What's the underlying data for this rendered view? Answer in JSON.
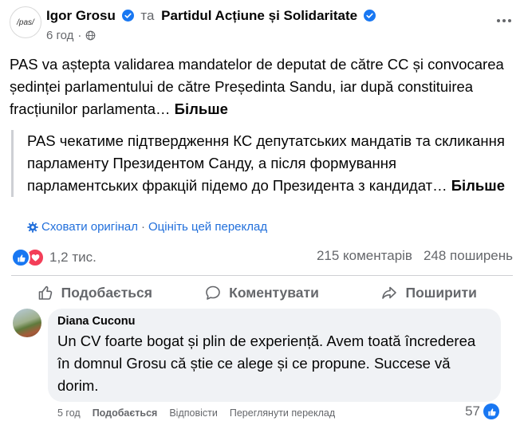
{
  "post": {
    "author": "Igor Grosu",
    "separator": "та",
    "page_name": "Partidul Acțiune și Solidaritate",
    "page_avatar_text": "/pas/",
    "time": "6 год",
    "text": "PAS va aștepta validarea mandatelor de deputat de către CC și convocarea ședinței parlamentului de către Președinta Sandu, iar după constituirea fracțiunilor parlamenta…",
    "see_more": "Більше",
    "translation_text": "PAS чекатиме підтвердження КС депутатських мандатів та скликання парламенту Президентом Санду, а після формування парламентських фракцій підемо до Президента з кандидат…",
    "translation_see_more": "Більше",
    "hide_original": "Сховати оригінал",
    "link_separator": "·",
    "rate_translation": "Оцініть цей переклад"
  },
  "stats": {
    "reactions": "1,2 тис.",
    "comments": "215 коментарів",
    "shares": "248 поширень"
  },
  "actions": {
    "like": "Подобається",
    "comment": "Коментувати",
    "share": "Поширити"
  },
  "comment": {
    "author": "Diana Cuconu",
    "text": "Un CV foarte bogat și plin de experiență. Avem toată încrederea în domnul Grosu că știe ce alege și ce propune. Succese vă dorim.",
    "time": "5 год",
    "like": "Подобається",
    "reply": "Відповісти",
    "see_translation": "Переглянути переклад",
    "likes": "57"
  },
  "icons": {
    "verified": "verified-badge-icon",
    "globe": "globe-icon",
    "more": "more-options-icon",
    "gear": "gear-icon",
    "like": "thumbs-up-icon",
    "love": "heart-icon",
    "comment": "comment-bubble-icon",
    "share": "share-arrow-icon"
  },
  "colors": {
    "brand_blue": "#1877f2",
    "link_blue": "#216fdb",
    "love_red": "#f33e58",
    "secondary_text": "#65676b",
    "bubble_bg": "#f0f2f5"
  }
}
